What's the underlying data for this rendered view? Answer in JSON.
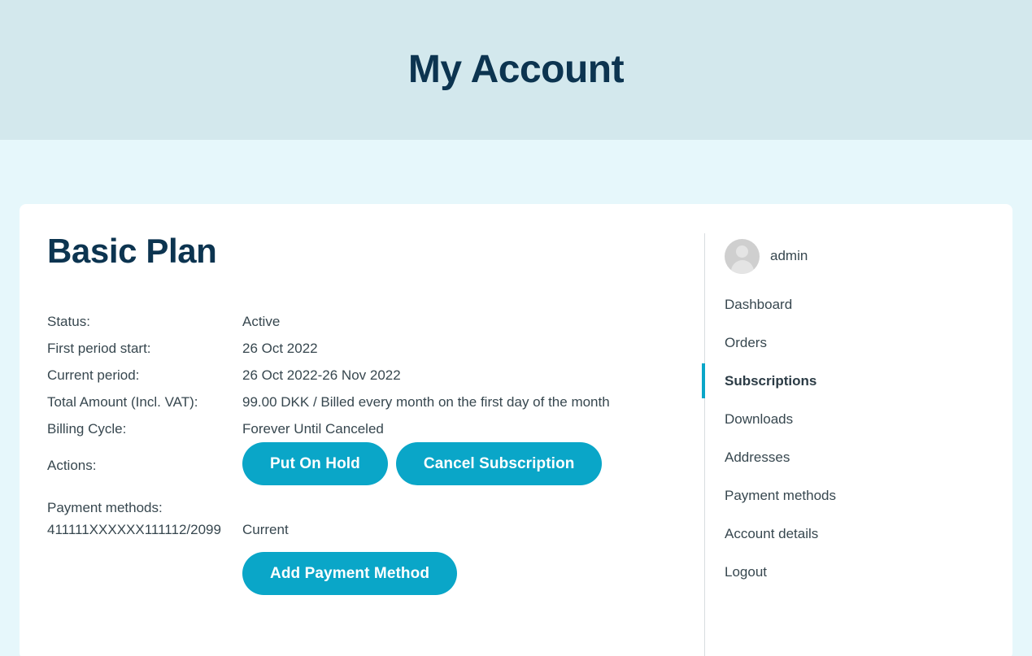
{
  "header": {
    "title": "My Account"
  },
  "main": {
    "plan_title": "Basic Plan",
    "details": [
      {
        "label": "Status:",
        "value": "Active"
      },
      {
        "label": "First period start:",
        "value": "26 Oct 2022"
      },
      {
        "label": "Current period:",
        "value": "26 Oct 2022-26 Nov 2022"
      },
      {
        "label": "Total Amount (Incl. VAT):",
        "value": "99.00 DKK / Billed every month on the first day of the month"
      },
      {
        "label": "Billing Cycle:",
        "value": "Forever Until Canceled"
      }
    ],
    "actions_label": "Actions:",
    "buttons": {
      "put_on_hold": "Put On Hold",
      "cancel_subscription": "Cancel Subscription",
      "add_payment_method": "Add Payment Method"
    },
    "payment_methods_label": "Payment methods:",
    "payment_method": {
      "card": "411111XXXXXX111112/2099",
      "status": "Current"
    }
  },
  "sidebar": {
    "user": "admin",
    "items": [
      {
        "label": "Dashboard",
        "active": false
      },
      {
        "label": "Orders",
        "active": false
      },
      {
        "label": "Subscriptions",
        "active": true
      },
      {
        "label": "Downloads",
        "active": false
      },
      {
        "label": "Addresses",
        "active": false
      },
      {
        "label": "Payment methods",
        "active": false
      },
      {
        "label": "Account details",
        "active": false
      },
      {
        "label": "Logout",
        "active": false
      }
    ]
  },
  "colors": {
    "accent": "#0aa6c8",
    "heading": "#0c3450",
    "header_band": "#d3e8ed",
    "page_background": "#e6f7fb",
    "body_text": "#37474f"
  }
}
